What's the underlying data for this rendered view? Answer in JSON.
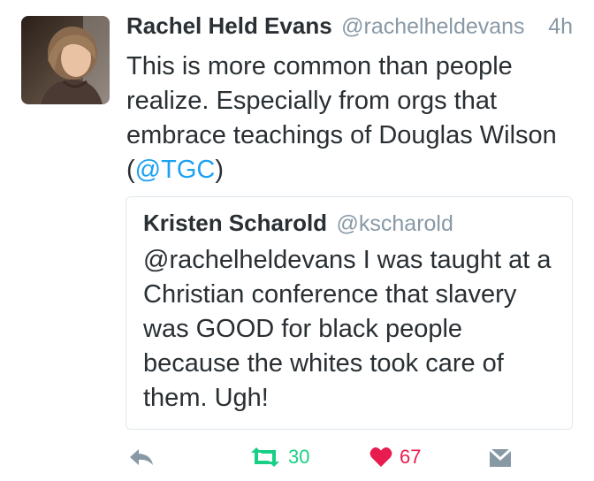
{
  "tweet": {
    "author_name": "Rachel Held Evans",
    "author_handle": "@rachelheldevans",
    "timestamp": "4h",
    "text_before": "This is more common than people realize. Especially from orgs that embrace teachings of Douglas Wilson (",
    "mention": "@TGC",
    "text_after": ")"
  },
  "quoted_tweet": {
    "author_name": "Kristen Scharold",
    "author_handle": "@kscharold",
    "text": "@rachelheldevans I was taught at a Christian conference that slavery was GOOD for black people because the whites took care of them. Ugh!"
  },
  "actions": {
    "reply_icon": "reply-arrow-icon",
    "retweet_icon": "retweet-icon",
    "retweet_count": "30",
    "retweet_color": "#19cf86",
    "like_icon": "heart-icon",
    "like_count": "67",
    "like_color": "#e81c4f",
    "dm_icon": "envelope-icon"
  },
  "colors": {
    "text": "#292f33",
    "secondary": "#8899a6",
    "link": "#1da1f2",
    "border": "#e1e8ed"
  }
}
